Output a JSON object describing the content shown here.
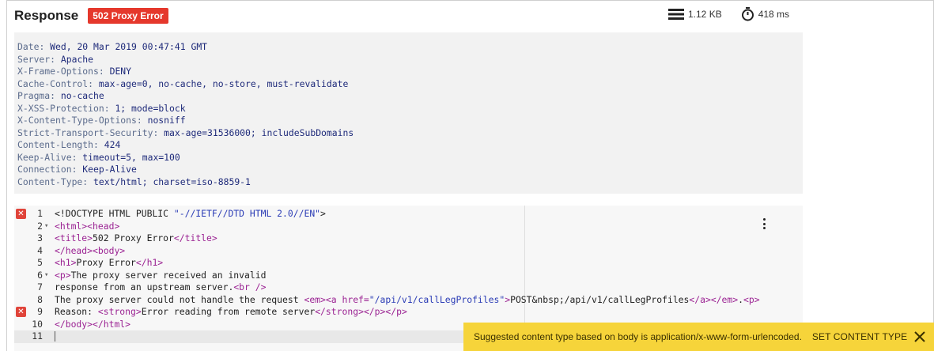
{
  "response": {
    "title": "Response",
    "status_badge": "502 Proxy Error",
    "size": "1.12 KB",
    "time": "418 ms"
  },
  "headers": [
    {
      "key": "Date",
      "value": "Wed, 20 Mar 2019 00:47:41 GMT"
    },
    {
      "key": "Server",
      "value": "Apache"
    },
    {
      "key": "X-Frame-Options",
      "value": "DENY"
    },
    {
      "key": "Cache-Control",
      "value": "max-age=0, no-cache, no-store, must-revalidate"
    },
    {
      "key": "Pragma",
      "value": "no-cache"
    },
    {
      "key": "X-XSS-Protection",
      "value": "1; mode=block"
    },
    {
      "key": "X-Content-Type-Options",
      "value": "nosniff"
    },
    {
      "key": "Strict-Transport-Security",
      "value": "max-age=31536000; includeSubDomains"
    },
    {
      "key": "Content-Length",
      "value": "424"
    },
    {
      "key": "Keep-Alive",
      "value": "timeout=5, max=100"
    },
    {
      "key": "Connection",
      "value": "Keep-Alive"
    },
    {
      "key": "Content-Type",
      "value": "text/html; charset=iso-8859-1"
    }
  ],
  "body_lines": [
    {
      "num": "1",
      "error": true,
      "fold": false,
      "text": "<!DOCTYPE HTML PUBLIC \"-//IETF//DTD HTML 2.0//EN\">"
    },
    {
      "num": "2",
      "error": false,
      "fold": true,
      "text": "<html><head>"
    },
    {
      "num": "3",
      "error": false,
      "fold": false,
      "text": "<title>502 Proxy Error</title>"
    },
    {
      "num": "4",
      "error": false,
      "fold": false,
      "text": "</head><body>"
    },
    {
      "num": "5",
      "error": false,
      "fold": false,
      "text": "<h1>Proxy Error</h1>"
    },
    {
      "num": "6",
      "error": false,
      "fold": true,
      "text": "<p>The proxy server received an invalid"
    },
    {
      "num": "7",
      "error": false,
      "fold": false,
      "text": "response from an upstream server.<br />"
    },
    {
      "num": "8",
      "error": false,
      "fold": false,
      "text": "The proxy server could not handle the request <em><a href=\"/api/v1/callLegProfiles\">POST&nbsp;/api/v1/callLegProfiles</a></em>.<p>"
    },
    {
      "num": "9",
      "error": true,
      "fold": false,
      "text": "Reason: <strong>Error reading from remote server</strong></p></p>"
    },
    {
      "num": "10",
      "error": false,
      "fold": false,
      "text": "</body></html>"
    },
    {
      "num": "11",
      "error": false,
      "fold": false,
      "text": ""
    }
  ],
  "toast": {
    "message": "Suggested content type based on body is application/x-www-form-urlencoded.",
    "action": "SET CONTENT TYPE"
  },
  "icons": {
    "size": "size-icon",
    "timer": "timer-icon",
    "menu": "more-vertical-icon",
    "close": "close-icon",
    "error": "error-marker-icon"
  },
  "colors": {
    "badge": "#e5382c",
    "toast": "#f6d43a",
    "tag": "#9b2393",
    "string": "#2a3bb5",
    "header_value": "#1e2a7a"
  }
}
